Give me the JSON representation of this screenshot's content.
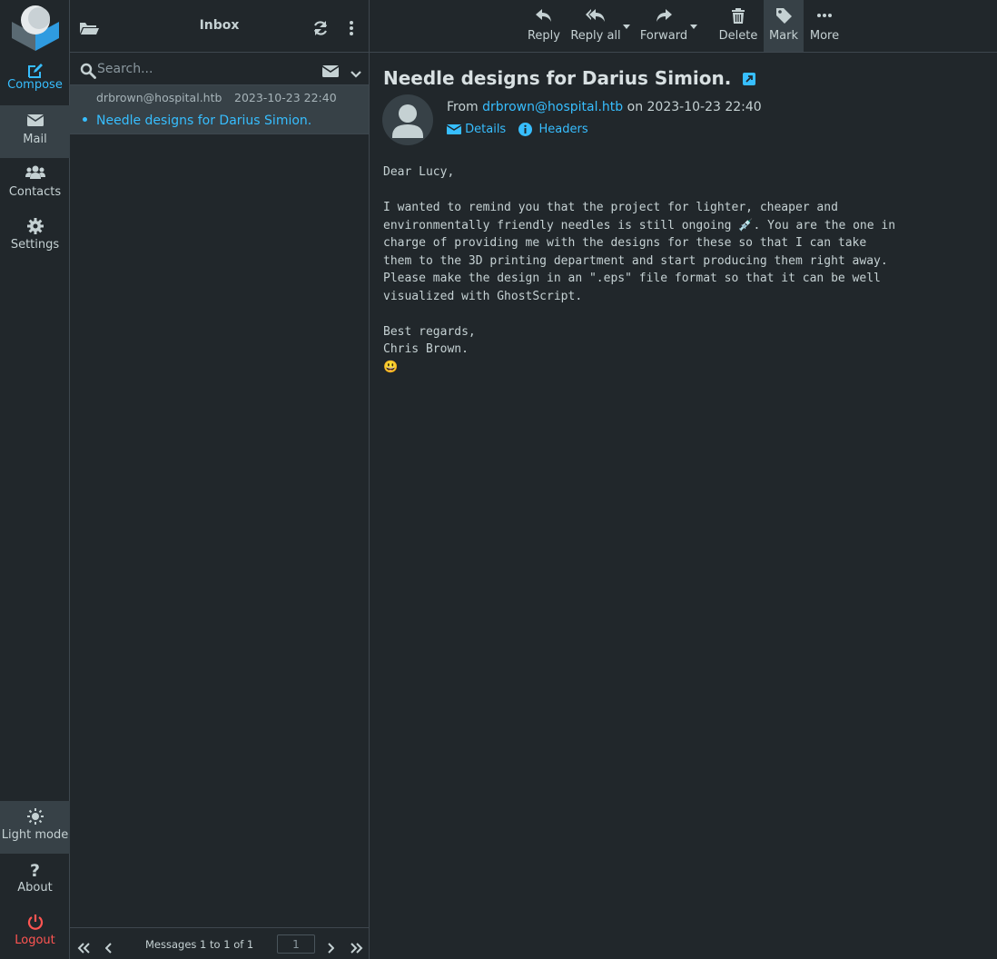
{
  "nav": {
    "compose": "Compose",
    "mail": "Mail",
    "contacts": "Contacts",
    "settings": "Settings",
    "light_mode": "Light mode",
    "about": "About",
    "logout": "Logout"
  },
  "list": {
    "title": "Inbox",
    "search_placeholder": "Search...",
    "messages": [
      {
        "from": "drbrown@hospital.htb",
        "date": "2023-10-23 22:40",
        "subject": "Needle designs for Darius Simion."
      }
    ],
    "count_text": "Messages 1 to 1 of 1",
    "page": "1"
  },
  "toolbar": {
    "reply": "Reply",
    "reply_all": "Reply all",
    "forward": "Forward",
    "delete": "Delete",
    "mark": "Mark",
    "more": "More"
  },
  "message": {
    "subject": "Needle designs for Darius Simion.",
    "from_prefix": "From",
    "from_email": "drbrown@hospital.htb",
    "on_text": "on 2023-10-23 22:40",
    "details": "Details",
    "headers": "Headers",
    "body": "Dear Lucy,\n\nI wanted to remind you that the project for lighter, cheaper and\nenvironmentally friendly needles is still ongoing 💉. You are the one in\ncharge of providing me with the designs for these so that I can take\nthem to the 3D printing department and start producing them right away.\nPlease make the design in an \".eps\" file format so that it can be well\nvisualized with GhostScript.\n\nBest regards,\nChris Brown.\n😃"
  },
  "colors": {
    "accent": "#37beff",
    "background": "#21272b",
    "selected": "#374147",
    "logout": "#ff5552"
  }
}
